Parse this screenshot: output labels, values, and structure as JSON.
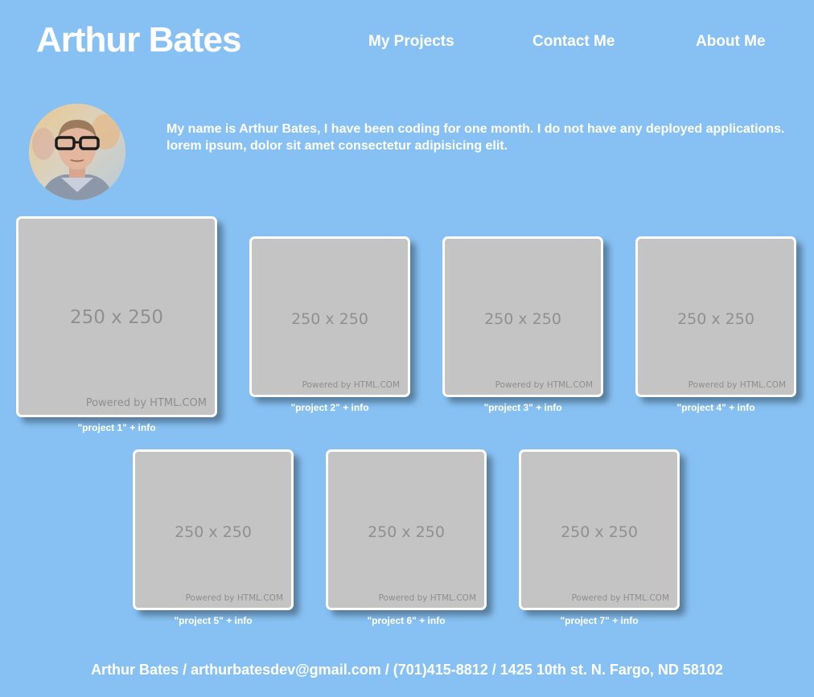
{
  "header": {
    "brand": "Arthur Bates",
    "nav": [
      {
        "label": "My Projects"
      },
      {
        "label": "Contact Me"
      },
      {
        "label": "About Me"
      }
    ]
  },
  "about": {
    "bio_line1": "My name is Arthur Bates, I have been coding for one month. I do not have any deployed applications.",
    "bio_line2": "lorem ipsum, dolor sit amet consectetur adipisicing elit."
  },
  "projects": [
    {
      "placeholder": "250 x 250",
      "powered_by": "Powered by HTML.COM",
      "caption": "\"project 1\" + info"
    },
    {
      "placeholder": "250 x 250",
      "powered_by": "Powered by HTML.COM",
      "caption": "\"project 2\" + info"
    },
    {
      "placeholder": "250 x 250",
      "powered_by": "Powered by HTML.COM",
      "caption": "\"project 3\" + info"
    },
    {
      "placeholder": "250 x 250",
      "powered_by": "Powered by HTML.COM",
      "caption": "\"project 4\" + info"
    },
    {
      "placeholder": "250 x 250",
      "powered_by": "Powered by HTML.COM",
      "caption": "\"project 5\" + info"
    },
    {
      "placeholder": "250 x 250",
      "powered_by": "Powered by HTML.COM",
      "caption": "\"project 6\" + info"
    },
    {
      "placeholder": "250 x 250",
      "powered_by": "Powered by HTML.COM",
      "caption": "\"project 7\" + info"
    }
  ],
  "footer": {
    "contact": "Arthur Bates / arthurbatesdev@gmail.com / (701)415-8812 / 1425 10th st. N. Fargo, ND 58102"
  },
  "colors": {
    "background": "#87c1f4",
    "text": "#ffffff",
    "card": "#c4c4c4"
  }
}
